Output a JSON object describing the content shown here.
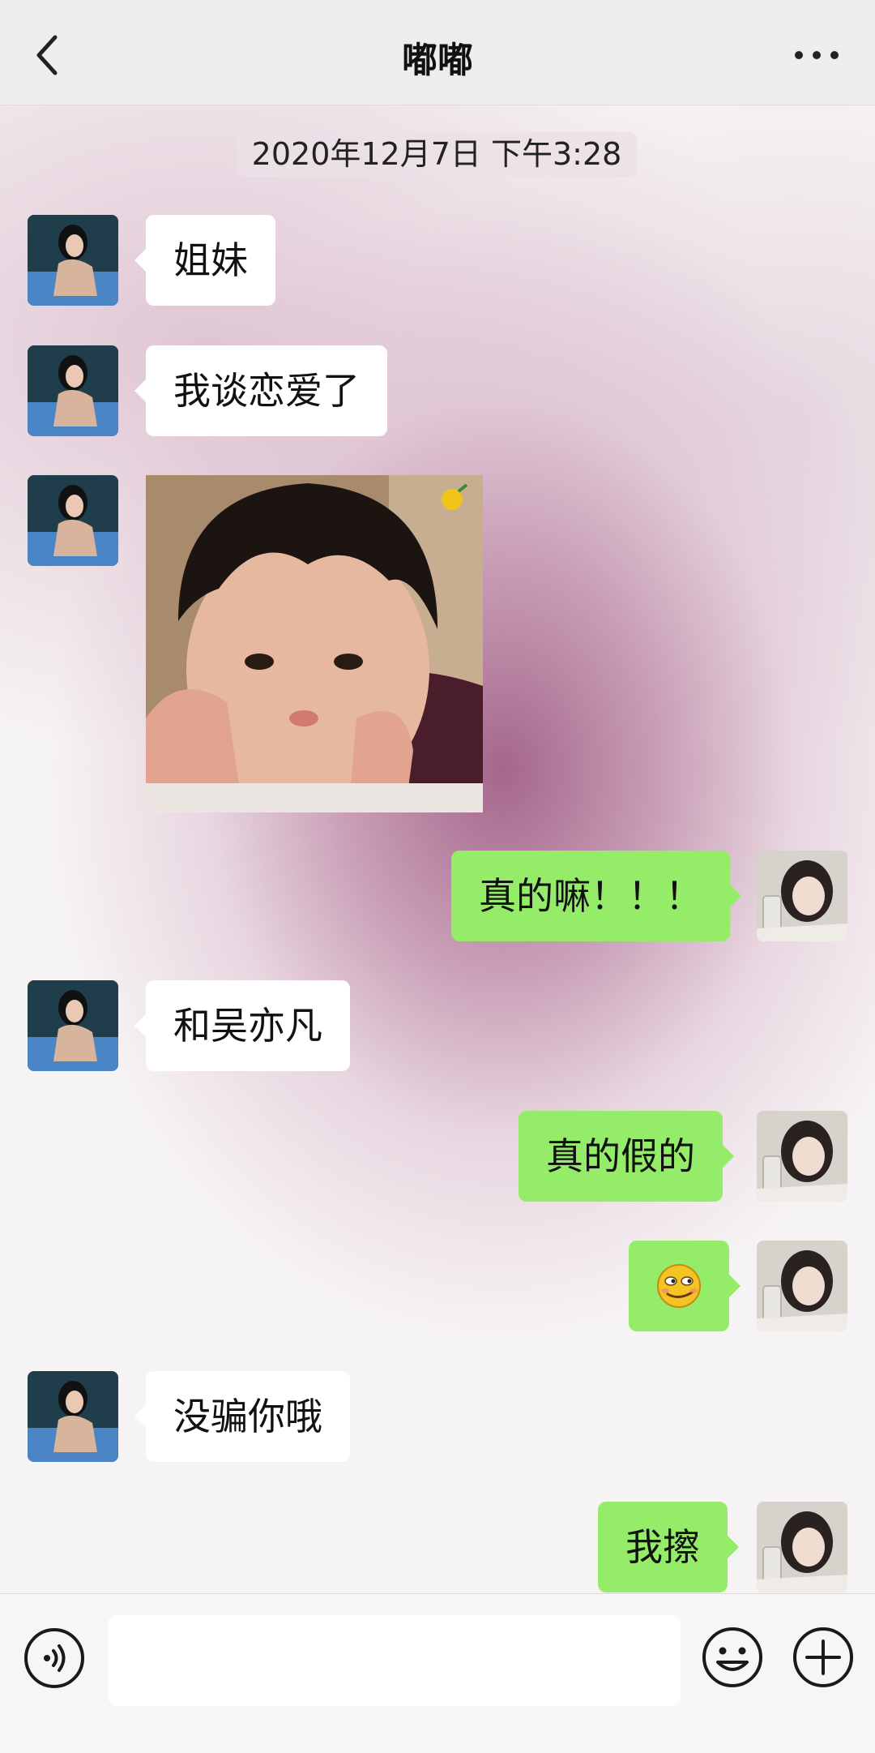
{
  "header": {
    "title": "嘟嘟",
    "back_icon": "chevron-left-icon",
    "more_icon": "more-horizontal-icon"
  },
  "timestamp": "2020年12月7日 下午3:28",
  "messages": [
    {
      "side": "left",
      "type": "text",
      "text": "姐妹"
    },
    {
      "side": "left",
      "type": "text",
      "text": "我谈恋爱了"
    },
    {
      "side": "left",
      "type": "image",
      "icon": "photo-child-meme"
    },
    {
      "side": "right",
      "type": "text",
      "text": "真的嘛！！！"
    },
    {
      "side": "left",
      "type": "text",
      "text": "和吴亦凡"
    },
    {
      "side": "right",
      "type": "text",
      "text": "真的假的"
    },
    {
      "side": "right",
      "type": "emoji",
      "icon": "smirk-emoji-icon"
    },
    {
      "side": "left",
      "type": "text",
      "text": "没骗你哦"
    },
    {
      "side": "right",
      "type": "text",
      "text": "我擦"
    }
  ],
  "input_bar": {
    "voice_icon": "voice-icon",
    "input_value": "",
    "emoji_icon": "emoji-icon",
    "plus_icon": "plus-icon"
  },
  "colors": {
    "bubble_self": "#95ec69",
    "bubble_other": "#ffffff",
    "nav_bg": "#ededed",
    "chat_bg_accent": "#a05f87"
  }
}
